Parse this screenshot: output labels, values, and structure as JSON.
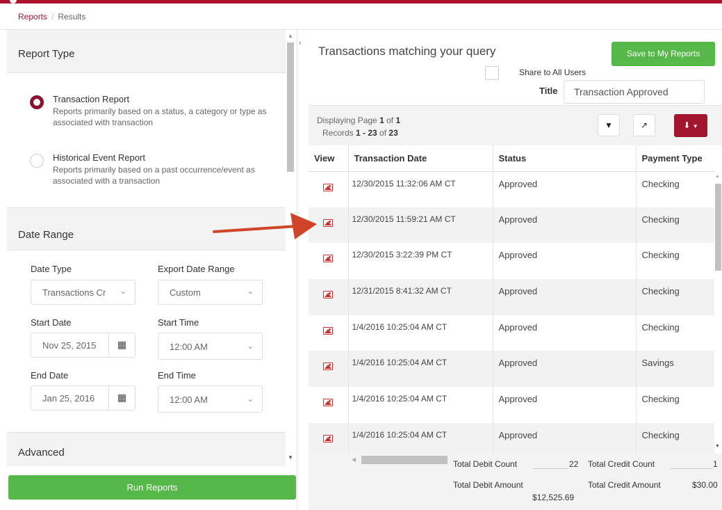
{
  "breadcrumb": {
    "reports": "Reports",
    "results": "Results"
  },
  "report_type": {
    "heading": "Report Type",
    "options": [
      {
        "title": "Transaction Report",
        "desc": "Reports primarily based on a status, a category or type as associated with transaction",
        "selected": true
      },
      {
        "title": "Historical Event Report",
        "desc": "Reports primarily based on a past occurrence/event as associated with a transaction",
        "selected": false
      }
    ]
  },
  "date_range": {
    "heading": "Date Range",
    "date_type_label": "Date Type",
    "date_type_value": "Transactions Cr",
    "export_range_label": "Export Date Range",
    "export_range_value": "Custom",
    "start_date_label": "Start Date",
    "start_date_value": "Nov 25, 2015",
    "start_time_label": "Start Time",
    "start_time_value": "12:00 AM",
    "end_date_label": "End Date",
    "end_date_value": "Jan 25, 2016",
    "end_time_label": "End Time",
    "end_time_value": "12:00 AM"
  },
  "advanced": {
    "heading": "Advanced"
  },
  "run_button": "Run Reports",
  "results": {
    "title": "Transactions matching your query",
    "save_button": "Save to My Reports",
    "share_label": "Share to All Users",
    "title_label": "Title",
    "title_value": "Transaction Approved",
    "paging": {
      "prefix": "Displaying Page ",
      "page": "1",
      "mid": " of ",
      "pages": "1"
    },
    "records": {
      "prefix": "Records ",
      "range": "1 - 23",
      "mid": " of ",
      "total": "23"
    },
    "columns": [
      "View",
      "Transaction Date",
      "Status",
      "Payment Type"
    ],
    "rows": [
      {
        "date": "12/30/2015 11:32:06 AM CT",
        "status": "Approved",
        "payment": "Checking"
      },
      {
        "date": "12/30/2015 11:59:21 AM CT",
        "status": "Approved",
        "payment": "Checking"
      },
      {
        "date": "12/30/2015 3:22:39 PM CT",
        "status": "Approved",
        "payment": "Checking"
      },
      {
        "date": "12/31/2015 8:41:32 AM CT",
        "status": "Approved",
        "payment": "Checking"
      },
      {
        "date": "1/4/2016 10:25:04 AM CT",
        "status": "Approved",
        "payment": "Checking"
      },
      {
        "date": "1/4/2016 10:25:04 AM CT",
        "status": "Approved",
        "payment": "Savings"
      },
      {
        "date": "1/4/2016 10:25:04 AM CT",
        "status": "Approved",
        "payment": "Checking"
      },
      {
        "date": "1/4/2016 10:25:04 AM CT",
        "status": "Approved",
        "payment": "Checking"
      }
    ],
    "totals": {
      "debit_count_label": "Total Debit Count",
      "debit_count": "22",
      "credit_count_label": "Total Credit Count",
      "credit_count": "1",
      "debit_amount_label": "Total Debit Amount",
      "debit_amount": "$12,525.69",
      "credit_amount_label": "Total Credit Amount",
      "credit_amount": "$30.00"
    }
  },
  "colors": {
    "brand": "#a3152e",
    "success": "#57b84a",
    "arrow": "#d0452a"
  }
}
